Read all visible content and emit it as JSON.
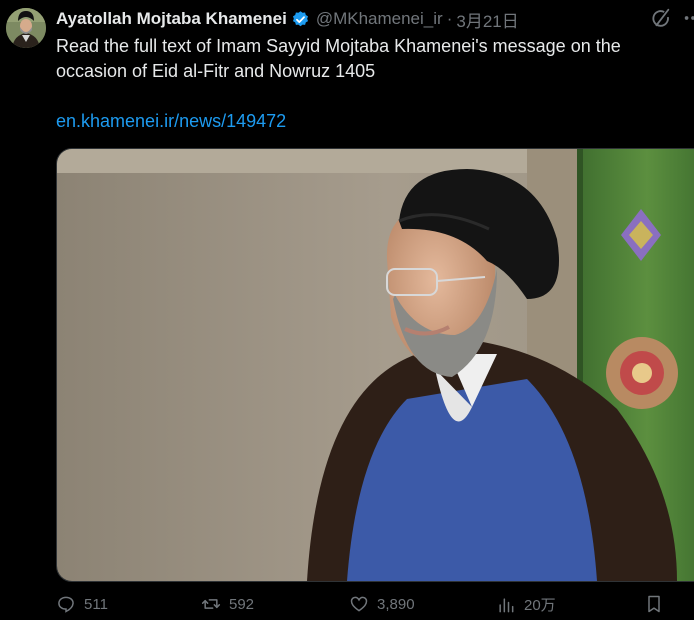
{
  "tweet": {
    "display_name": "Ayatollah Mojtaba Khamenei",
    "handle": "@MKhamenei_ir",
    "separator": "·",
    "date": "3月21日",
    "text": "Read the full text of Imam Sayyid Mojtaba Khamenei's message on the occasion of Eid al-Fitr and Nowruz 1405",
    "link": "en.khamenei.ir/news/149472"
  },
  "actions": {
    "replies": "511",
    "reposts": "592",
    "likes": "3,890",
    "views": "20万"
  },
  "colors": {
    "background": "#000000",
    "text": "#e7e9ea",
    "secondary": "#71767b",
    "link": "#1d9bf0",
    "verified": "#1d9bf0"
  },
  "icons": [
    "verified-badge-icon",
    "grok-icon",
    "more-icon",
    "reply-icon",
    "repost-icon",
    "like-icon",
    "views-icon",
    "bookmark-icon"
  ]
}
